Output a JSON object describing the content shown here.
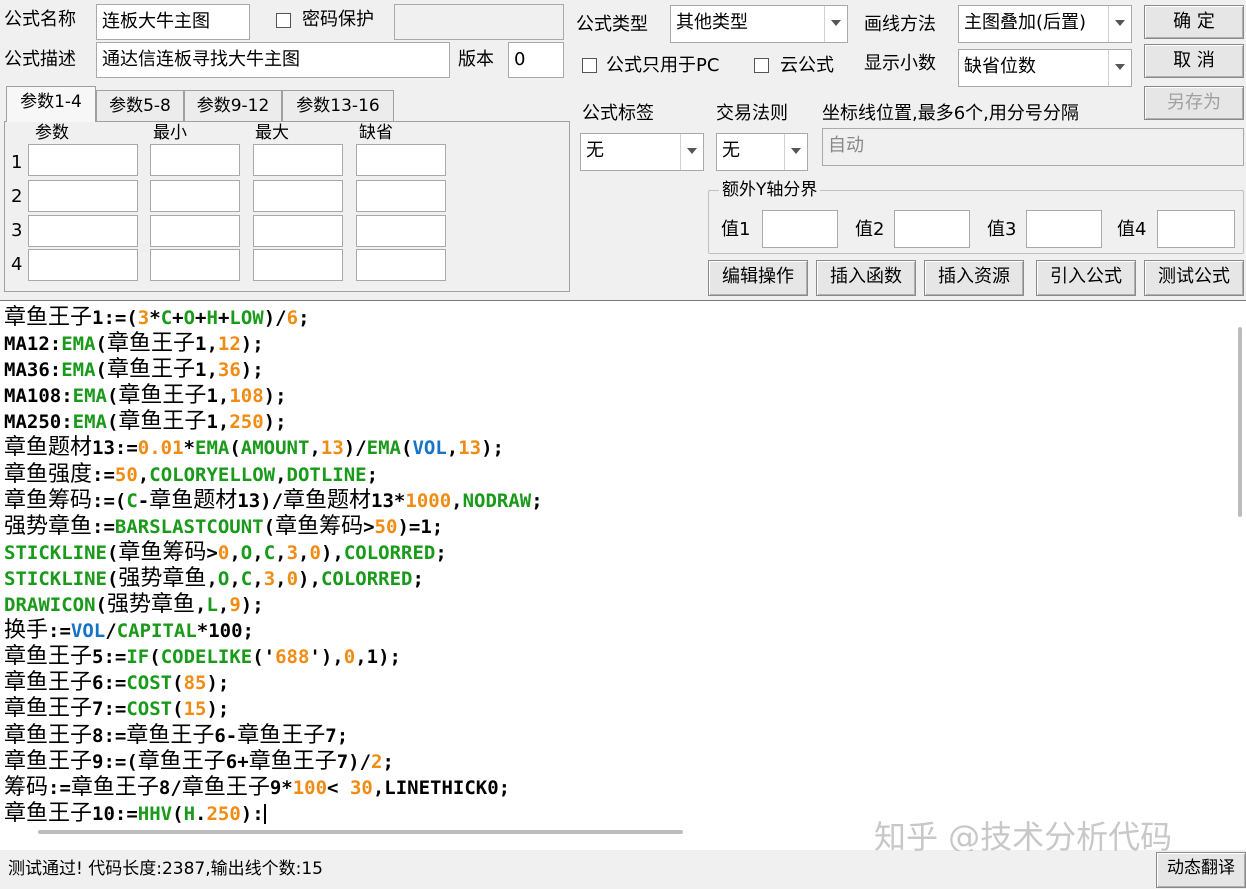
{
  "header": {
    "name_label": "公式名称",
    "name_value": "连板大牛主图",
    "password_label": "密码保护",
    "desc_label": "公式描述",
    "desc_value": "通达信连板寻找大牛主图",
    "version_label": "版本",
    "version_value": "0",
    "type_label": "公式类型",
    "type_value": "其他类型",
    "draw_label": "画线方法",
    "draw_value": "主图叠加(后置)",
    "pc_only_label": "公式只用于PC",
    "cloud_label": "云公式",
    "decimal_label": "显示小数",
    "decimal_value": "缺省位数"
  },
  "buttons": {
    "ok": "确  定",
    "cancel": "取  消",
    "save_as": "另存为",
    "edit": "编辑操作",
    "insert_func": "插入函数",
    "insert_res": "插入资源",
    "import": "引入公式",
    "test": "测试公式",
    "translate": "动态翻译"
  },
  "tabs": [
    "参数1-4",
    "参数5-8",
    "参数9-12",
    "参数13-16"
  ],
  "params": {
    "col_headers": [
      "参数",
      "最小",
      "最大",
      "缺省"
    ],
    "row_labels": [
      "1",
      "2",
      "3",
      "4"
    ]
  },
  "right": {
    "tag_label": "公式标签",
    "tag_value": "无",
    "rule_label": "交易法则",
    "rule_value": "无",
    "coord_label": "坐标线位置,最多6个,用分号分隔",
    "coord_value": "自动",
    "yaxis_group": "额外Y轴分界",
    "v1": "值1",
    "v2": "值2",
    "v3": "值3",
    "v4": "值4"
  },
  "colors": {
    "text": "#000000",
    "function": "#1a9a1a",
    "number": "#f08c14",
    "builtin": "#1673c8"
  },
  "code_lines": [
    [
      [
        "t",
        "章鱼王子"
      ],
      [
        "k",
        "1:=("
      ],
      [
        "n",
        "3"
      ],
      [
        "k",
        "*"
      ],
      [
        "f",
        "C"
      ],
      [
        "k",
        "+"
      ],
      [
        "f",
        "O"
      ],
      [
        "k",
        "+"
      ],
      [
        "f",
        "H"
      ],
      [
        "k",
        "+"
      ],
      [
        "f",
        "LOW"
      ],
      [
        "k",
        ")/"
      ],
      [
        "n",
        "6"
      ],
      [
        "k",
        ";"
      ]
    ],
    [
      [
        "k",
        "MA12:"
      ],
      [
        "f",
        "EMA"
      ],
      [
        "k",
        "("
      ],
      [
        "t",
        "章鱼王子"
      ],
      [
        "k",
        "1,"
      ],
      [
        "n",
        "12"
      ],
      [
        "k",
        ");"
      ]
    ],
    [
      [
        "k",
        "MA36:"
      ],
      [
        "f",
        "EMA"
      ],
      [
        "k",
        "("
      ],
      [
        "t",
        "章鱼王子"
      ],
      [
        "k",
        "1,"
      ],
      [
        "n",
        "36"
      ],
      [
        "k",
        ");"
      ]
    ],
    [
      [
        "k",
        "MA108:"
      ],
      [
        "f",
        "EMA"
      ],
      [
        "k",
        "("
      ],
      [
        "t",
        "章鱼王子"
      ],
      [
        "k",
        "1,"
      ],
      [
        "n",
        "108"
      ],
      [
        "k",
        ");"
      ]
    ],
    [
      [
        "k",
        "MA250:"
      ],
      [
        "f",
        "EMA"
      ],
      [
        "k",
        "("
      ],
      [
        "t",
        "章鱼王子"
      ],
      [
        "k",
        "1,"
      ],
      [
        "n",
        "250"
      ],
      [
        "k",
        ");"
      ]
    ],
    [
      [
        "t",
        "章鱼题材"
      ],
      [
        "k",
        "13:="
      ],
      [
        "n",
        "0.01"
      ],
      [
        "k",
        "*"
      ],
      [
        "f",
        "EMA"
      ],
      [
        "k",
        "("
      ],
      [
        "f",
        "AMOUNT"
      ],
      [
        "k",
        ","
      ],
      [
        "n",
        "13"
      ],
      [
        "k",
        ")/"
      ],
      [
        "f",
        "EMA"
      ],
      [
        "k",
        "("
      ],
      [
        "b",
        "VOL"
      ],
      [
        "k",
        ","
      ],
      [
        "n",
        "13"
      ],
      [
        "k",
        ");"
      ]
    ],
    [
      [
        "t",
        "章鱼强度"
      ],
      [
        "k",
        ":="
      ],
      [
        "n",
        "50"
      ],
      [
        "k",
        ","
      ],
      [
        "f",
        "COLORYELLOW"
      ],
      [
        "k",
        ","
      ],
      [
        "f",
        "DOTLINE"
      ],
      [
        "k",
        ";"
      ]
    ],
    [
      [
        "t",
        "章鱼筹码"
      ],
      [
        "k",
        ":=("
      ],
      [
        "f",
        "C"
      ],
      [
        "k",
        "-"
      ],
      [
        "t",
        "章鱼题材"
      ],
      [
        "k",
        "13)/"
      ],
      [
        "t",
        "章鱼题材"
      ],
      [
        "k",
        "13*"
      ],
      [
        "n",
        "1000"
      ],
      [
        "k",
        ","
      ],
      [
        "f",
        "NODRAW"
      ],
      [
        "k",
        ";"
      ]
    ],
    [
      [
        "t",
        "强势章鱼"
      ],
      [
        "k",
        ":="
      ],
      [
        "f",
        "BARSLASTCOUNT"
      ],
      [
        "k",
        "("
      ],
      [
        "t",
        "章鱼筹码"
      ],
      [
        "k",
        ">"
      ],
      [
        "n",
        "50"
      ],
      [
        "k",
        ")=1;"
      ]
    ],
    [
      [
        "f",
        "STICKLINE"
      ],
      [
        "k",
        "("
      ],
      [
        "t",
        "章鱼筹码"
      ],
      [
        "k",
        ">"
      ],
      [
        "n",
        "0"
      ],
      [
        "k",
        ","
      ],
      [
        "f",
        "O"
      ],
      [
        "k",
        ","
      ],
      [
        "f",
        "C"
      ],
      [
        "k",
        ","
      ],
      [
        "n",
        "3"
      ],
      [
        "k",
        ","
      ],
      [
        "n",
        "0"
      ],
      [
        "k",
        "),"
      ],
      [
        "f",
        "COLORRED"
      ],
      [
        "k",
        ";"
      ]
    ],
    [
      [
        "f",
        "STICKLINE"
      ],
      [
        "k",
        "("
      ],
      [
        "t",
        "强势章鱼"
      ],
      [
        "k",
        ","
      ],
      [
        "f",
        "O"
      ],
      [
        "k",
        ","
      ],
      [
        "f",
        "C"
      ],
      [
        "k",
        ","
      ],
      [
        "n",
        "3"
      ],
      [
        "k",
        ","
      ],
      [
        "n",
        "0"
      ],
      [
        "k",
        "),"
      ],
      [
        "f",
        "COLORRED"
      ],
      [
        "k",
        ";"
      ]
    ],
    [
      [
        "f",
        "DRAWICON"
      ],
      [
        "k",
        "("
      ],
      [
        "t",
        "强势章鱼"
      ],
      [
        "k",
        ","
      ],
      [
        "f",
        "L"
      ],
      [
        "k",
        ","
      ],
      [
        "n",
        "9"
      ],
      [
        "k",
        ");"
      ]
    ],
    [
      [
        "t",
        "换手"
      ],
      [
        "k",
        ":="
      ],
      [
        "b",
        "VOL"
      ],
      [
        "k",
        "/"
      ],
      [
        "f",
        "CAPITAL"
      ],
      [
        "k",
        "*100;"
      ]
    ],
    [
      [
        "t",
        "章鱼王子"
      ],
      [
        "k",
        "5:="
      ],
      [
        "f",
        "IF"
      ],
      [
        "k",
        "("
      ],
      [
        "f",
        "CODELIKE"
      ],
      [
        "k",
        "('"
      ],
      [
        "n",
        "688"
      ],
      [
        "k",
        "'),"
      ],
      [
        "n",
        "0"
      ],
      [
        "k",
        ",1);"
      ]
    ],
    [
      [
        "t",
        "章鱼王子"
      ],
      [
        "k",
        "6:="
      ],
      [
        "f",
        "COST"
      ],
      [
        "k",
        "("
      ],
      [
        "n",
        "85"
      ],
      [
        "k",
        ");"
      ]
    ],
    [
      [
        "t",
        "章鱼王子"
      ],
      [
        "k",
        "7:="
      ],
      [
        "f",
        "COST"
      ],
      [
        "k",
        "("
      ],
      [
        "n",
        "15"
      ],
      [
        "k",
        ");"
      ]
    ],
    [
      [
        "t",
        "章鱼王子"
      ],
      [
        "k",
        "8:="
      ],
      [
        "t",
        "章鱼王子"
      ],
      [
        "k",
        "6-"
      ],
      [
        "t",
        "章鱼王子"
      ],
      [
        "k",
        "7;"
      ]
    ],
    [
      [
        "t",
        "章鱼王子"
      ],
      [
        "k",
        "9:=("
      ],
      [
        "t",
        "章鱼王子"
      ],
      [
        "k",
        "6+"
      ],
      [
        "t",
        "章鱼王子"
      ],
      [
        "k",
        "7)/"
      ],
      [
        "n",
        "2"
      ],
      [
        "k",
        ";"
      ]
    ],
    [
      [
        "t",
        "筹码"
      ],
      [
        "k",
        ":="
      ],
      [
        "t",
        "章鱼王子"
      ],
      [
        "k",
        "8/"
      ],
      [
        "t",
        "章鱼王子"
      ],
      [
        "k",
        "9*"
      ],
      [
        "n",
        "100"
      ],
      [
        "k",
        "< "
      ],
      [
        "n",
        "30"
      ],
      [
        "k",
        ",LINETHICK0;"
      ]
    ],
    [
      [
        "t",
        "章鱼王子"
      ],
      [
        "k",
        "10:="
      ],
      [
        "f",
        "HHV"
      ],
      [
        "k",
        "("
      ],
      [
        "f",
        "H"
      ],
      [
        "k",
        "."
      ],
      [
        "n",
        "250"
      ],
      [
        "k",
        "):"
      ]
    ]
  ],
  "status_text": "测试通过! 代码长度:2387,输出线个数:15",
  "watermark": "知乎 @技术分析代码"
}
